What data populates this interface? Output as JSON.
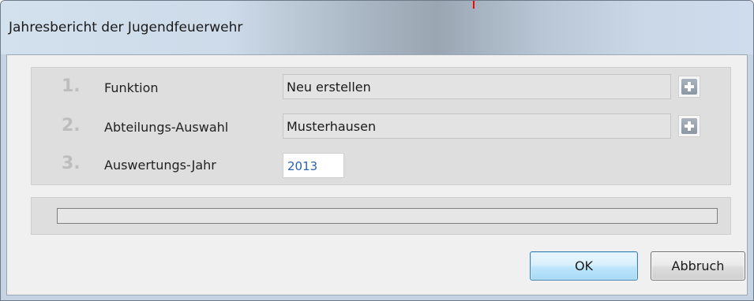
{
  "window": {
    "title": "Jahresbericht der Jugendfeuerwehr"
  },
  "form": {
    "rows": [
      {
        "number": "1.",
        "label": "Funktion",
        "value": "Neu erstellen",
        "add_icon": "plus-icon"
      },
      {
        "number": "2.",
        "label": "Abteilungs-Auswahl",
        "value": "Musterhausen",
        "add_icon": "plus-icon"
      },
      {
        "number": "3.",
        "label": "Auswertungs-Jahr",
        "value": "2013"
      }
    ]
  },
  "progress": {
    "fraction": 0
  },
  "buttons": {
    "ok_label": "OK",
    "cancel_label": "Abbruch"
  },
  "colors": {
    "step_number": "#bdbdbd",
    "year_text": "#2a62b3",
    "ok_border": "#3c7fb1"
  }
}
